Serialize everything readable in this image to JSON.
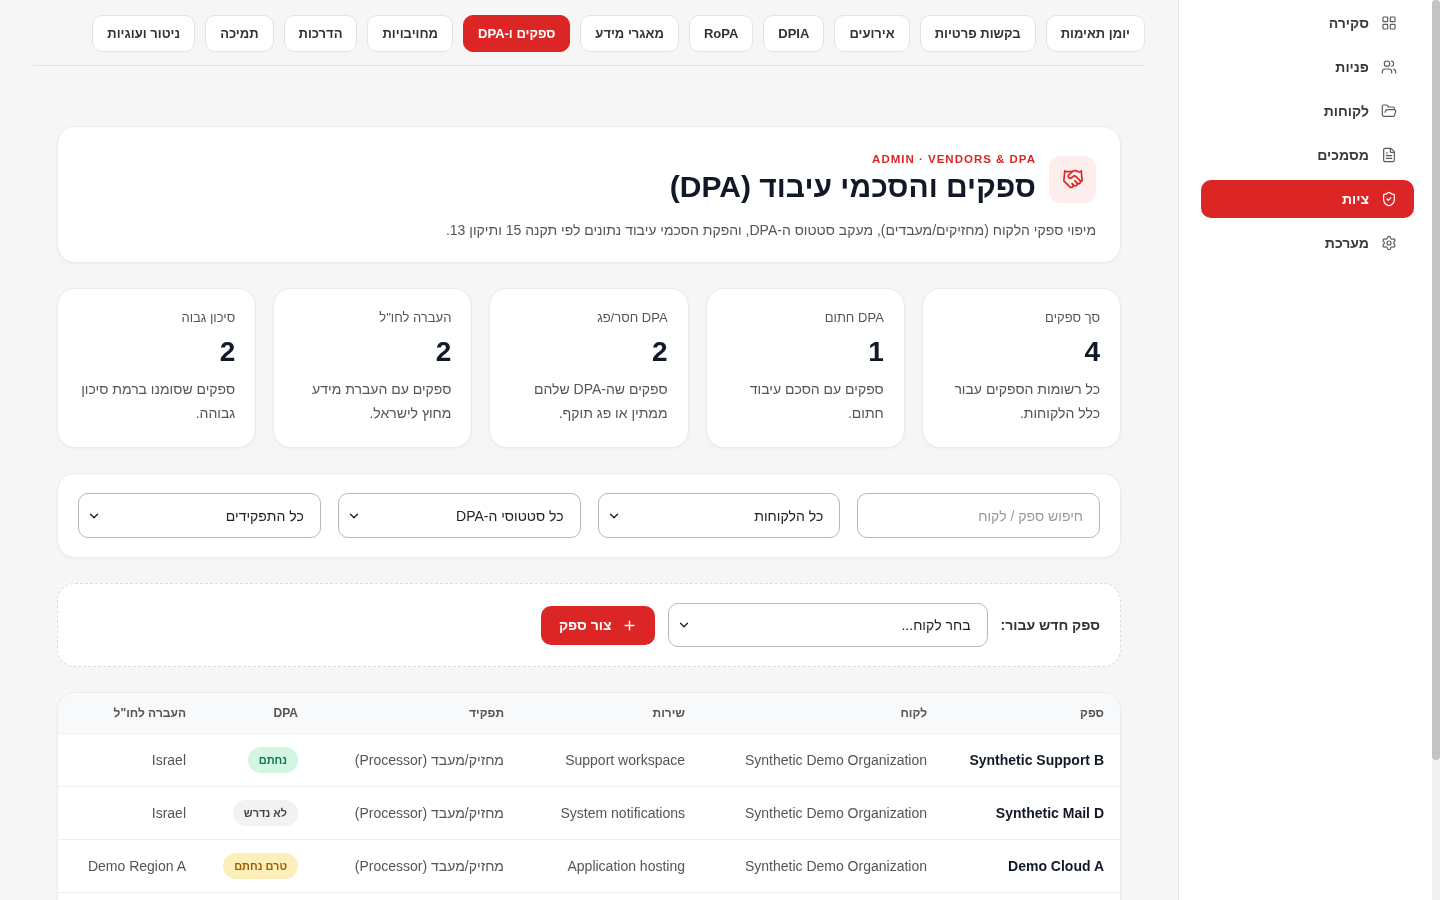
{
  "sidebar": {
    "items": [
      {
        "label": "סקירה",
        "selected": false
      },
      {
        "label": "פניות",
        "selected": false
      },
      {
        "label": "לקוחות",
        "selected": false
      },
      {
        "label": "מסמכים",
        "selected": false
      },
      {
        "label": "ציות",
        "selected": true
      },
      {
        "label": "מערכת",
        "selected": false
      }
    ]
  },
  "tabs": [
    {
      "label": "יומן תאימות",
      "selected": false
    },
    {
      "label": "בקשות פרטיות",
      "selected": false
    },
    {
      "label": "אירועים",
      "selected": false
    },
    {
      "label": "DPIA",
      "selected": false
    },
    {
      "label": "RoPA",
      "selected": false
    },
    {
      "label": "מאגרי מידע",
      "selected": false
    },
    {
      "label": "ספקים ו-DPA",
      "selected": true
    },
    {
      "label": "מחויבויות",
      "selected": false
    },
    {
      "label": "הדרכות",
      "selected": false
    },
    {
      "label": "תמיכה",
      "selected": false
    },
    {
      "label": "ניטור ועוגיות",
      "selected": false
    }
  ],
  "header": {
    "eyebrow": "ADMIN · VENDORS & DPA",
    "title": "ספקים והסכמי עיבוד (DPA)",
    "description": "מיפוי ספקי הלקוח (מחזיקים/מעבדים), מעקב סטטוס ה-DPA, והפקת הסכמי עיבוד נתונים לפי תקנה 15 ותיקון 13."
  },
  "stats": [
    {
      "label": "סך ספקים",
      "value": "4",
      "description": "כל רשומות הספקים עבור כלל הלקוחות."
    },
    {
      "label": "DPA חתום",
      "value": "1",
      "description": "ספקים עם הסכם עיבוד חתום."
    },
    {
      "label": "DPA חסר/פג",
      "value": "2",
      "description": "ספקים שה-DPA שלהם ממתין או פג תוקף."
    },
    {
      "label": "העברה לחו\"ל",
      "value": "2",
      "description": "ספקים עם העברת מידע מחוץ לישראל."
    },
    {
      "label": "סיכון גבוה",
      "value": "2",
      "description": "ספקים שסומנו ברמת סיכון גבוהה."
    }
  ],
  "filters": {
    "search": {
      "placeholder": "חיפוש ספק / לקוח"
    },
    "selects": [
      {
        "value": "כל הלקוחות"
      },
      {
        "value": "כל סטטוסי ה-DPA"
      },
      {
        "value": "כל התפקידים"
      }
    ]
  },
  "new_vendor": {
    "label": "ספק חדש עבור:",
    "client_select": {
      "value": "בחר לקוח..."
    },
    "button": "צור ספק"
  },
  "table": {
    "columns": [
      "ספק",
      "לקוח",
      "שירות",
      "תפקיד",
      "DPA",
      "העברה לחו\"ל"
    ],
    "rows": [
      {
        "vendor": "Synthetic Support B",
        "client": "Synthetic Demo Organization",
        "service": "Support workspace",
        "role": "מחזיק/מעבד (Processor)",
        "dpa": {
          "label": "נחתם",
          "color": "#d3f6e2"
        },
        "transfer": "Israel"
      },
      {
        "vendor": "Synthetic Mail D",
        "client": "Synthetic Demo Organization",
        "service": "System notifications",
        "role": "מחזיק/מעבד (Processor)",
        "dpa": {
          "label": "לא נדרש",
          "color": "#f1f2f4"
        },
        "transfer": "Israel"
      },
      {
        "vendor": "Demo Cloud A",
        "client": "Synthetic Demo Organization",
        "service": "Application hosting",
        "role": "מחזיק/מעבד (Processor)",
        "dpa": {
          "label": "טרם נחתם",
          "color": "#fdefb9"
        },
        "transfer": "Demo Region A"
      }
    ]
  }
}
